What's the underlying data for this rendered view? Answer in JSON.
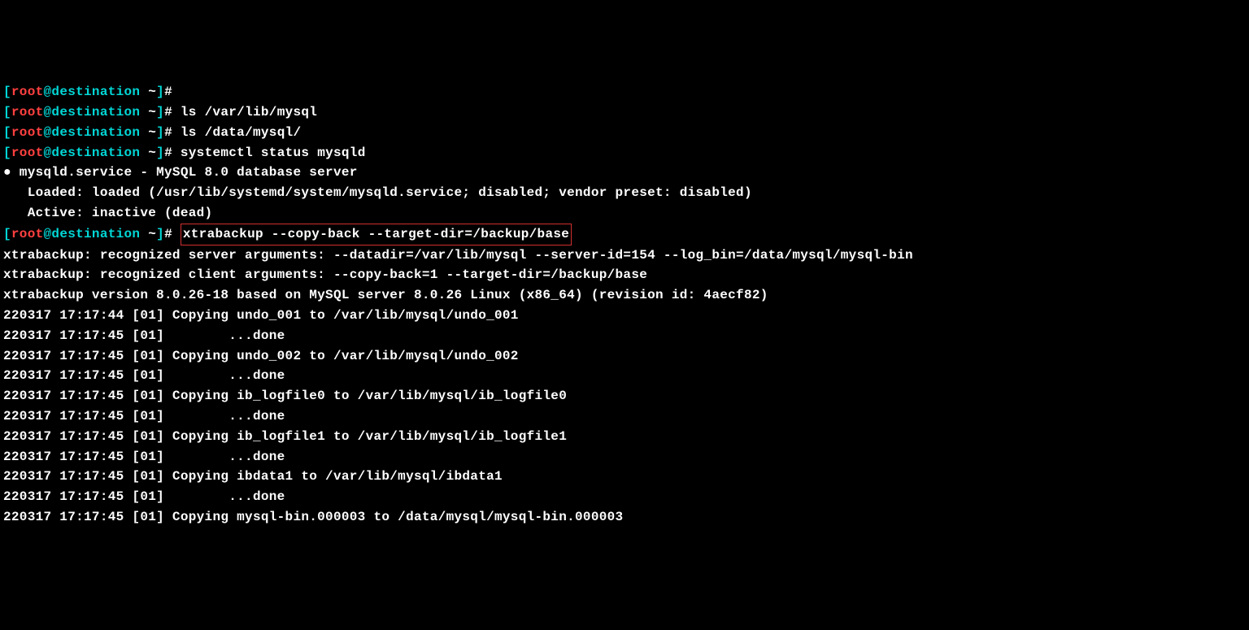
{
  "prompt": {
    "open": "[",
    "user": "root",
    "at": "@",
    "host": "destination",
    "path": " ~",
    "close": "]# "
  },
  "top_truncated": "[root@destination ~]# ",
  "cmd1": "ls /var/lib/mysql",
  "cmd2": "ls /data/mysql/",
  "cmd3": "systemctl status mysqld",
  "status": {
    "unit": "● mysqld.service - MySQL 8.0 database server",
    "loaded": "   Loaded: loaded (/usr/lib/systemd/system/mysqld.service; disabled; vendor preset: disabled)",
    "active": "   Active: inactive (dead)"
  },
  "cmd4": "xtrabackup --copy-back --target-dir=/backup/base",
  "out": [
    "xtrabackup: recognized server arguments: --datadir=/var/lib/mysql --server-id=154 --log_bin=/data/mysql/mysql-bin ",
    "xtrabackup: recognized client arguments: --copy-back=1 --target-dir=/backup/base ",
    "xtrabackup version 8.0.26-18 based on MySQL server 8.0.26 Linux (x86_64) (revision id: 4aecf82)",
    "220317 17:17:44 [01] Copying undo_001 to /var/lib/mysql/undo_001",
    "220317 17:17:45 [01]        ...done",
    "220317 17:17:45 [01] Copying undo_002 to /var/lib/mysql/undo_002",
    "220317 17:17:45 [01]        ...done",
    "220317 17:17:45 [01] Copying ib_logfile0 to /var/lib/mysql/ib_logfile0",
    "220317 17:17:45 [01]        ...done",
    "220317 17:17:45 [01] Copying ib_logfile1 to /var/lib/mysql/ib_logfile1",
    "220317 17:17:45 [01]        ...done",
    "220317 17:17:45 [01] Copying ibdata1 to /var/lib/mysql/ibdata1",
    "220317 17:17:45 [01]        ...done",
    "220317 17:17:45 [01] Copying mysql-bin.000003 to /data/mysql/mysql-bin.000003"
  ]
}
